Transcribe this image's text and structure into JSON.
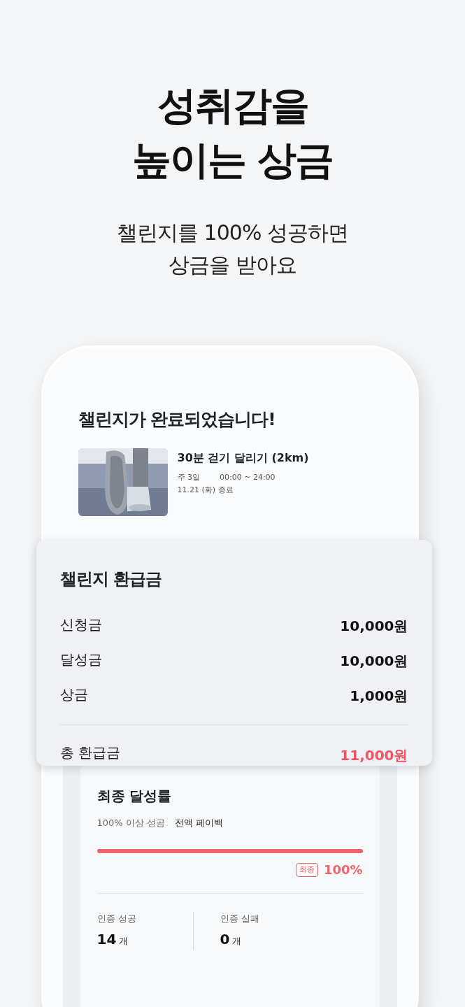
{
  "headline": "성취감을\n높이는 상금",
  "subtitle": "챌린지를 100% 성공하면\n상금을 받아요",
  "challenge": {
    "title": "챌린지가 완료되었습니다!",
    "name": "30분 걷기 달리기 (2km)",
    "frequency": "주 3일",
    "time": "00:00 ~ 24:00",
    "end": "11.21 (화) 종료"
  },
  "refund": {
    "title": "챌린지 환급금",
    "rows": [
      {
        "label": "신청금",
        "value": "10,000원"
      },
      {
        "label": "달성금",
        "value": "10,000원"
      },
      {
        "label": "상금",
        "value": "1,000원"
      }
    ],
    "total": {
      "label": "총 환급금",
      "value": "11,000원"
    }
  },
  "achievement": {
    "title": "최종 달성률",
    "rule_label": "100% 이상 성공",
    "rule_value": "전액 페이백",
    "level": 1.0,
    "badge": "최종",
    "percent": "100%",
    "stats": [
      {
        "label": "인증 성공",
        "value": "14",
        "unit": "개"
      },
      {
        "label": "인증 실패",
        "value": "0",
        "unit": "개"
      }
    ]
  }
}
